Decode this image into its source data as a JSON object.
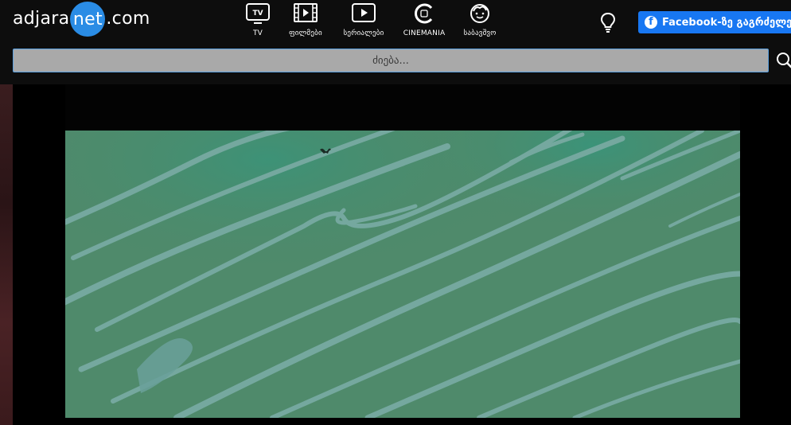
{
  "logo": {
    "prefix": "adjara",
    "highlight": "net",
    "suffix": ".com"
  },
  "nav": {
    "items": [
      {
        "key": "tv",
        "label": "TV",
        "icon": "tv-icon"
      },
      {
        "key": "movies",
        "label": "ფილმები",
        "icon": "film-icon"
      },
      {
        "key": "series",
        "label": "სერიალები",
        "icon": "play-icon"
      },
      {
        "key": "cinemania",
        "label": "CINEMANIA",
        "icon": "cinemania-icon"
      },
      {
        "key": "kids",
        "label": "საბავშვო",
        "icon": "kid-face-icon"
      }
    ]
  },
  "header": {
    "bulb_icon": "lightbulb-icon",
    "facebook_button_label": "Facebook-ზე გაგრძელება"
  },
  "search": {
    "placeholder": "ძიება...",
    "value": ""
  },
  "colors": {
    "accent": "#2a8ce5",
    "facebook": "#1877f2",
    "video_bg": "#4d8a6a",
    "video_streak": "#74a9a2"
  }
}
